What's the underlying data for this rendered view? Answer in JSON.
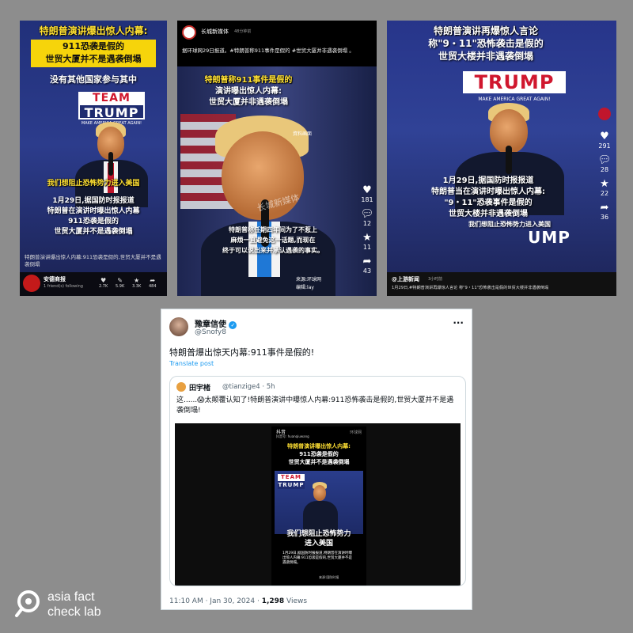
{
  "panel1": {
    "headline": "特朗普演讲爆出惊人内幕:",
    "banner_line1": "911恐袭是假的",
    "banner_line2": "世贸大厦并不是遇袭倒塌",
    "subhead": "没有其他国家参与其中",
    "sign_team": "TEAM",
    "sign_trump": "TRUMP",
    "sign_slogan": "MAKE AMERICA GREAT AGAIN!",
    "quote_line": "我们想阻止恐怖势力进入美国",
    "body_line1": "1月29日,据国防时报报道",
    "body_line2": "特朗普在演讲时曝出惊人内幕",
    "body_line3": "911恐袭是假的",
    "body_line4": "世贸大厦并不是遇袭倒塌",
    "caption": "特朗普演讲爆出惊人内幕:911恐袭是假的,世贸大厦并不是遇袭倒塌",
    "account": "安德商报",
    "account_sub": "1 friend(s) following",
    "stats": [
      "2.7K",
      "5.9K",
      "3.3K",
      "484"
    ]
  },
  "panel2": {
    "account": "长城新媒体",
    "time": "48分钟前",
    "text": "据环球网29日报道。#特朗普称911事件是假的 #世贸大厦并非遇袭倒塌 。",
    "headline1": "特朗普称911事件是假的",
    "headline2": "演讲曝出惊人内幕:",
    "headline3": "世贸大厦并非遇袭倒塌",
    "source_tag": "資料画面",
    "watermark": "长城新媒体",
    "body1": "特朗普称任期四年间为了不惹上",
    "body2": "麻烦一直避免这一话题,而现在",
    "body3": "终于可以说出来并承认遇袭的事实。",
    "credit1": "来源:环球网",
    "credit2": "编辑:lay",
    "stats": [
      "181",
      "12",
      "11",
      "43"
    ]
  },
  "panel3": {
    "headline1": "特朗普演讲再爆惊人言论",
    "headline2": "称\"9・11\"恐怖袭击是假的",
    "headline3": "世贸大楼并非遇袭倒塌",
    "sign_trump": "TRUMP",
    "sign_slogan": "MAKE AMERICA GREAT AGAIN!",
    "body1": "1月29日,据国防时报报道",
    "body2": "特朗普当在演讲时曝出惊人内幕:",
    "body3": "\"9・11\"恐袭事件是假的",
    "body4": "世贸大楼并非遇袭倒塌",
    "quote_line": "我们想阻止恐怖势力进入美国",
    "sign_partial": "UMP",
    "account": "@上游新闻",
    "time": "3小时前",
    "caption": "1月29日,#特朗普演讲再爆惊人言论 称\"9・11\"恐怖袭击是假的世贸大楼并非遇袭倒塌",
    "stats": [
      "291",
      "28",
      "22",
      "36"
    ]
  },
  "tweet": {
    "name": "豫章信使",
    "handle": "@Snofy8",
    "text": "特朗普爆出惊天内幕:911事件是假的!",
    "translate": "Translate post",
    "quoted_name": "田宇楮",
    "quoted_handle": "@tianzige4 · 5h",
    "quoted_text": "这......😱太颠覆认知了!特朗普演讲中曝惊人内幕:911恐怖袭击是假的,世贸大厦并不是遇袭倒塌!",
    "video_app": "抖音",
    "video_id": "抖音号: huanqiuwang",
    "video_watermark": "环球网",
    "video_headline1": "特朗普演讲曝出惊人内幕:",
    "video_headline2": "911恐袭是假的",
    "video_headline3": "世贸大厦并不是遇袭倒塌",
    "video_sign_team": "TEAM",
    "video_sign_trump": "TRUMP",
    "video_quote1": "我们想阻止恐怖势力",
    "video_quote2": "进入美国",
    "video_body": "1月29日,据国防时报报道,特朗普在演讲时曝出惊人内幕:911恐袭是假的,世贸大厦并不是遇袭倒塌。",
    "video_source": "来源:国防时报",
    "footer_time": "11:10 AM · Jan 30, 2024 · ",
    "views_count": "1,298",
    "views_label": " Views",
    "more": "···"
  },
  "logo": {
    "line1": "asia fact",
    "line2": "check lab"
  },
  "colors": {
    "yellow": "#f6d40b",
    "red": "#d0172e",
    "verified": "#1d9bf0",
    "background": "#8d8d8d"
  },
  "icons": [
    "heart-icon",
    "comment-icon",
    "star-icon",
    "share-icon",
    "verified-icon",
    "search-icon",
    "more-icon"
  ]
}
